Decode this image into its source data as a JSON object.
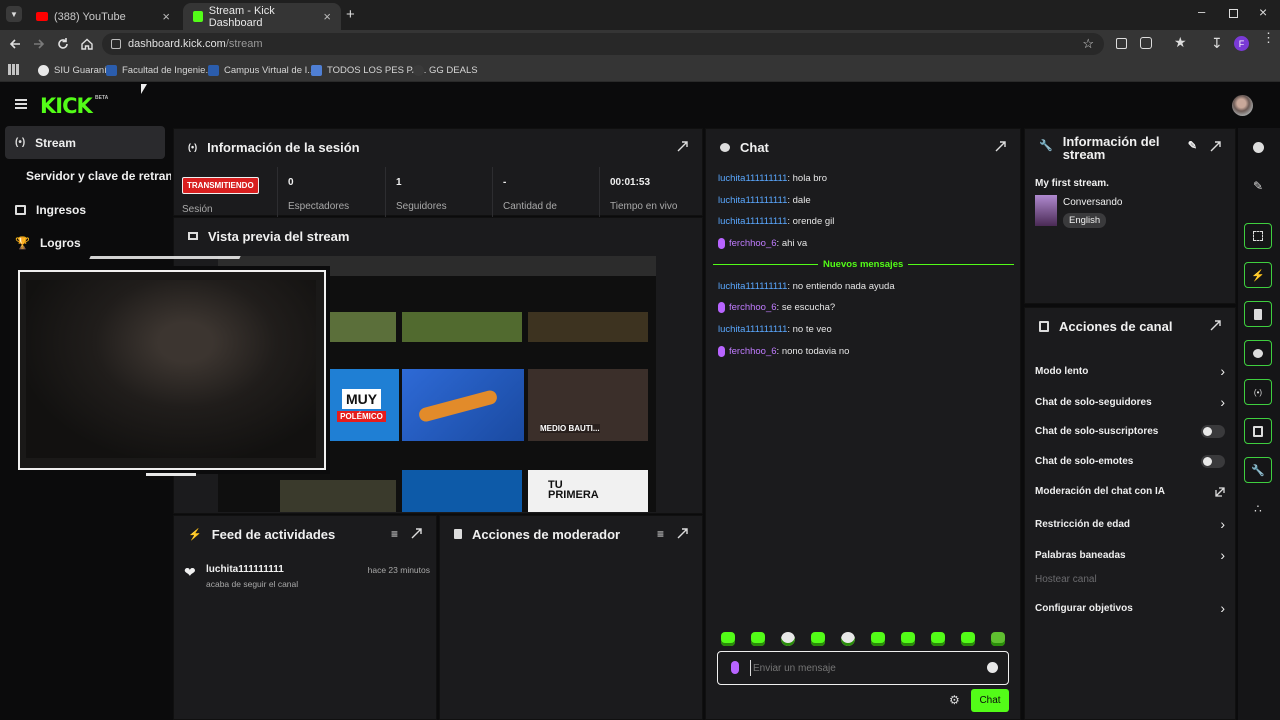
{
  "browser": {
    "tabs": [
      {
        "title": "(388) YouTube",
        "icon": "youtube-icon"
      },
      {
        "title": "Stream - Kick Dashboard",
        "icon": "kick-icon"
      }
    ],
    "url_host": "dashboard.kick.com",
    "url_path": "/stream",
    "profile_letter": "F",
    "bookmarks": [
      "SIU Guaraní",
      "Facultad de Ingenie...",
      "Campus Virtual de I...",
      "TODOS LOS PES PA...",
      "GG DEALS"
    ]
  },
  "app": {
    "logo": "KICK",
    "logo_badge": "BETA",
    "accent": "#53fc18"
  },
  "sidebar": {
    "items": [
      {
        "label": "Stream",
        "icon": "broadcast-icon",
        "active": true
      },
      {
        "label": "Servidor y clave de retransmisión",
        "icon": ""
      },
      {
        "label": "Ingresos",
        "icon": "chart-icon"
      },
      {
        "label": "Logros",
        "icon": "trophy-icon"
      }
    ]
  },
  "session": {
    "title": "Información de la sesión",
    "live_badge": "TRANSMITIENDO",
    "live_label": "Sesión",
    "stats": [
      {
        "value": "0",
        "label": "Espectadores"
      },
      {
        "value": "1",
        "label": "Seguidores"
      },
      {
        "value": "-",
        "label": "Cantidad de"
      },
      {
        "value": "00:01:53",
        "label": "Tiempo en vivo"
      }
    ]
  },
  "preview": {
    "title": "Vista previa del stream",
    "thumb_texts": [
      "MUY",
      "POLÉMICO",
      "MEDIO BAUTI...",
      "TU PRIMERA"
    ]
  },
  "feed": {
    "title": "Feed de actividades",
    "items": [
      {
        "user": "luchita111111111",
        "action": "acaba de seguir el canal",
        "time": "hace 23 minutos"
      }
    ]
  },
  "moderator": {
    "title": "Acciones de moderador"
  },
  "chat": {
    "title": "Chat",
    "messages_before": [
      {
        "user": "luchita111111111",
        "text": ": hola bro",
        "role": "viewer"
      },
      {
        "user": "luchita111111111",
        "text": ": dale",
        "role": "viewer"
      },
      {
        "user": "luchita111111111",
        "text": ": orende gil",
        "role": "viewer"
      },
      {
        "user": "ferchhoo_6",
        "text": ": ahi va",
        "role": "broadcaster"
      }
    ],
    "new_messages_label": "Nuevos mensajes",
    "messages_after": [
      {
        "user": "luchita111111111",
        "text": ": no entiendo nada ayuda",
        "role": "viewer"
      },
      {
        "user": "ferchhoo_6",
        "text": ": se escucha?",
        "role": "broadcaster"
      },
      {
        "user": "luchita111111111",
        "text": ": no te veo",
        "role": "viewer"
      },
      {
        "user": "ferchhoo_6",
        "text": ": nono todavia no",
        "role": "broadcaster"
      }
    ],
    "input_placeholder": "Enviar un mensaje",
    "send_label": "Chat"
  },
  "stream_info": {
    "title": "Información del stream",
    "stream_title": "My first stream.",
    "category": "Conversando",
    "language": "English"
  },
  "channel_actions": {
    "title": "Acciones de canal",
    "items": [
      {
        "label": "Modo lento",
        "control": "chevron"
      },
      {
        "label": "Chat de solo-seguidores",
        "control": "chevron"
      },
      {
        "label": "Chat de solo-suscriptores",
        "control": "toggle",
        "on": false
      },
      {
        "label": "Chat de solo-emotes",
        "control": "toggle",
        "on": false
      },
      {
        "label": "Moderación del chat con IA",
        "control": "external"
      },
      {
        "label": "Restricción de edad",
        "control": "chevron"
      },
      {
        "label": "Palabras baneadas",
        "control": "chevron"
      },
      {
        "label": "Hostear canal",
        "control": "none",
        "disabled": true
      },
      {
        "label": "Configurar objetivos",
        "control": "chevron"
      }
    ]
  }
}
